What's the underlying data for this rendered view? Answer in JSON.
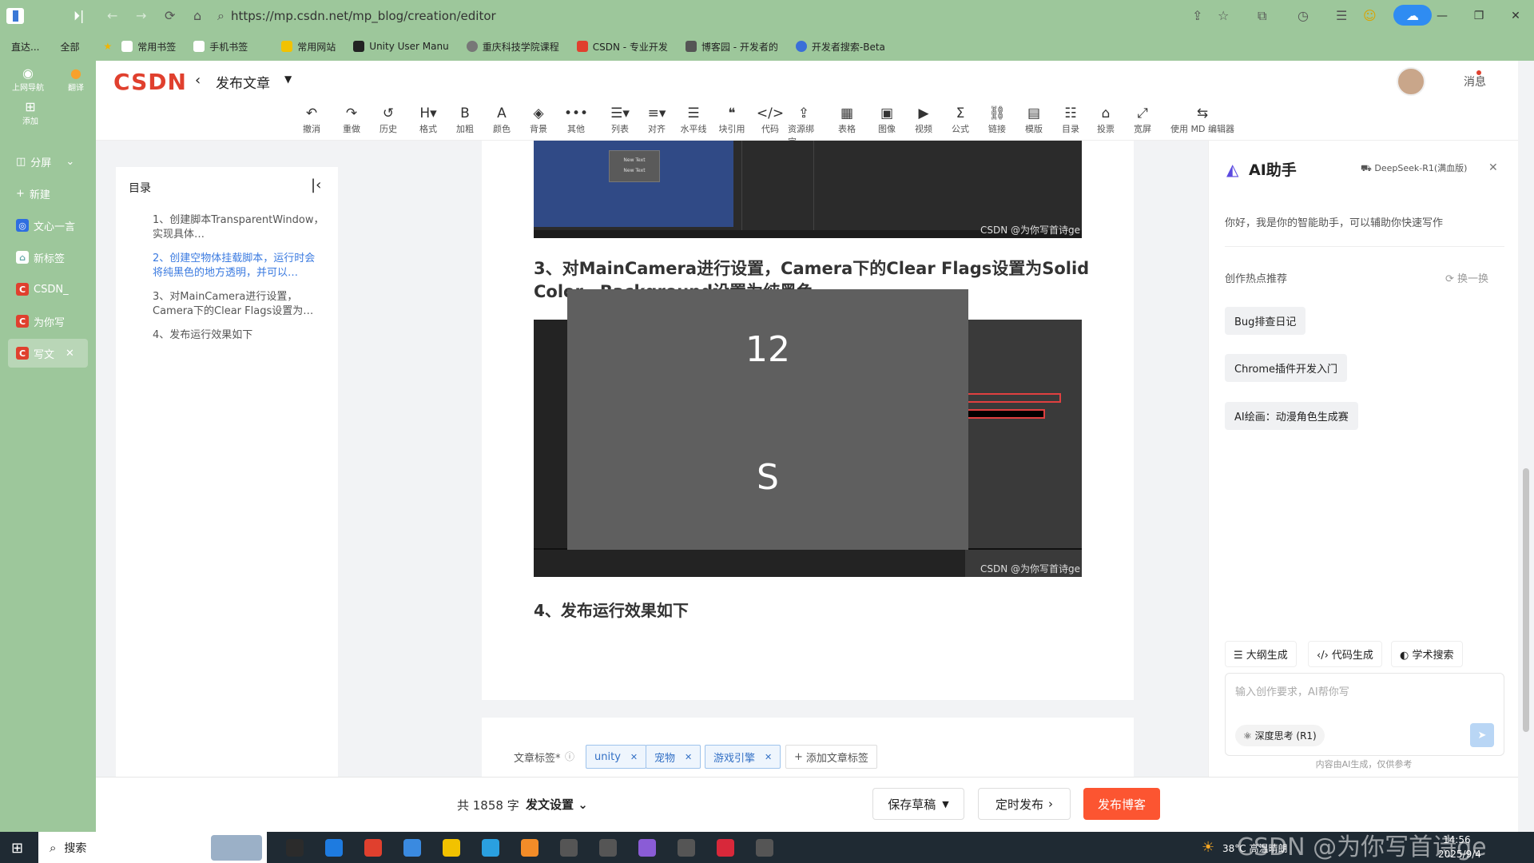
{
  "browser": {
    "url": "https://mp.csdn.net/mp_blog/creation/editor",
    "left_top_label": "直达...",
    "left_top_all": "全部",
    "bookmarks": [
      "常用书签",
      "手机书签",
      "常用网站",
      "Unity User Manu",
      "重庆科技学院课程",
      "CSDN - 专业开发",
      "博客园 - 开发者的",
      "开发者搜索-Beta"
    ],
    "side_tools": [
      "上网导航",
      "翻译",
      "添加"
    ],
    "split_label": "分屏",
    "new_label": "新建",
    "tabs": [
      "文心一言",
      "新标签",
      "CSDN_",
      "为你写",
      "写文"
    ]
  },
  "header": {
    "logo": "CSDN",
    "back": "发布文章",
    "message": "消息"
  },
  "toolbar": [
    {
      "icon": "↶",
      "label": "撤消"
    },
    {
      "icon": "↷",
      "label": "重做"
    },
    {
      "icon": "↺",
      "label": "历史"
    },
    {
      "icon": "H▾",
      "label": "格式"
    },
    {
      "icon": "B",
      "label": "加粗"
    },
    {
      "icon": "A",
      "label": "颜色"
    },
    {
      "icon": "◈",
      "label": "背景"
    },
    {
      "icon": "•••",
      "label": "其他"
    },
    {
      "icon": "☰▾",
      "label": "列表"
    },
    {
      "icon": "≡▾",
      "label": "对齐"
    },
    {
      "icon": "☰",
      "label": "水平线"
    },
    {
      "icon": "❝",
      "label": "块引用"
    },
    {
      "icon": "</>",
      "label": "代码"
    },
    {
      "icon": "⇪",
      "label": "资源绑定"
    },
    {
      "icon": "▦",
      "label": "表格"
    },
    {
      "icon": "▣",
      "label": "图像"
    },
    {
      "icon": "▶",
      "label": "视频"
    },
    {
      "icon": "Σ",
      "label": "公式"
    },
    {
      "icon": "⛓",
      "label": "链接"
    },
    {
      "icon": "▤",
      "label": "模版"
    },
    {
      "icon": "☷",
      "label": "目录"
    },
    {
      "icon": "⌂",
      "label": "投票"
    },
    {
      "icon": "⤢",
      "label": "宽屏"
    },
    {
      "icon": "⇆",
      "label": "使用 MD 编辑器"
    }
  ],
  "toc": {
    "title": "目录",
    "items": [
      "1、创建脚本TransparentWindow，实现具体…",
      "2、创建空物体挂载脚本，运行时会将纯黑色的地方透明，并可以…",
      "3、对MainCamera进行设置，Camera下的Clear Flags设置为…",
      "4、发布运行效果如下"
    ]
  },
  "doc": {
    "h3_line1": "3、对MainCamera进行设置，Camera下的Clear Flags设置为Solid",
    "h3_line2": "Color，Background设置为纯黑色",
    "h4": "4、发布运行效果如下",
    "watermark": "CSDN @为你写首诗ge",
    "overlay_top": "12",
    "overlay_bottom": "S",
    "newtext": "New Text"
  },
  "tags": {
    "label": "文章标签*",
    "items": [
      "unity",
      "宠物",
      "游戏引擎"
    ],
    "add": "添加文章标签"
  },
  "ai": {
    "title": "AI助手",
    "model": "DeepSeek-R1(满血版)",
    "greeting": "你好，我是你的智能助手，可以辅助你快速写作",
    "hot_title": "创作热点推荐",
    "refresh": "换一换",
    "suggestions": [
      "Bug排查日记",
      "Chrome插件开发入门",
      "AI绘画：动漫角色生成赛"
    ],
    "tools": [
      "大纲生成",
      "代码生成",
      "学术搜索"
    ],
    "placeholder": "输入创作要求，AI帮你写",
    "deep": "深度思考 (R1)",
    "disclaimer": "内容由AI生成，仅供参考"
  },
  "bottom": {
    "count": "共 1858 字",
    "settings": "发文设置",
    "save": "保存草稿",
    "schedule": "定时发布",
    "publish": "发布博客"
  },
  "taskbar": {
    "search": "搜索",
    "weather": "38°C 高温晴朗",
    "time": "14:56",
    "date": "2025/9/4",
    "watermark": "CSDN @为你写首诗ge"
  }
}
